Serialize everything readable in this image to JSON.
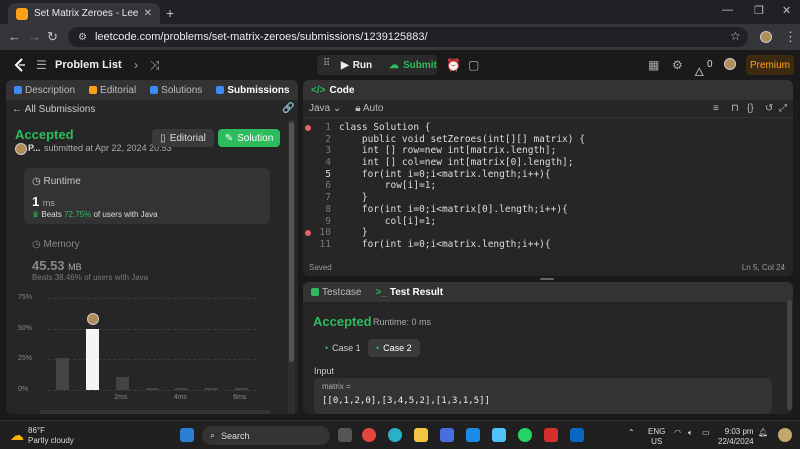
{
  "browser": {
    "tab_title": "Set Matrix Zeroes - LeetCode",
    "url": "leetcode.com/problems/set-matrix-zeroes/submissions/1239125883/"
  },
  "topbar": {
    "problem_list": "Problem List",
    "run": "Run",
    "submit": "Submit",
    "streak_count": "0",
    "premium": "Premium"
  },
  "left": {
    "tabs": [
      "Description",
      "Editorial",
      "Solutions",
      "Submissions"
    ],
    "back": "All Submissions",
    "status": "Accepted",
    "author": "P...",
    "submitted": "submitted at Apr 22, 2024 20:53",
    "editorial_btn": "Editorial",
    "solution_btn": "Solution",
    "runtime": {
      "label": "Runtime",
      "value": "1",
      "unit": "ms",
      "beats_prefix": "Beats",
      "beats_pct": "72.75%",
      "beats_suffix": "of users with Java"
    },
    "memory": {
      "label": "Memory",
      "value": "45.53",
      "unit": "MB",
      "beats_prefix": "Beats",
      "beats_pct": "38.46%",
      "beats_suffix": "of users with Java"
    }
  },
  "chart_data": {
    "type": "bar",
    "yticks": [
      "75%",
      "50%",
      "25%",
      "0%"
    ],
    "ylim": [
      0,
      75
    ],
    "xticks": [
      "2ms",
      "4ms",
      "6ms"
    ],
    "values": [
      26,
      50,
      11,
      1,
      1,
      1,
      1
    ],
    "highlight_index": 1
  },
  "code": {
    "title": "Code",
    "language": "Java",
    "format": "Auto",
    "saved": "Saved",
    "cursor": "Ln 5, Col 24",
    "lines": [
      "class Solution {",
      "    public void setZeroes(int[][] matrix) {",
      "    int [] row=new int[matrix.length];",
      "    int [] col=new int[matrix[0].length];",
      "    for(int i=0;i<matrix.length;i++){",
      "        row[i]=1;",
      "    }",
      "    for(int i=0;i<matrix[0].length;i++){",
      "        col[i]=1;",
      "    }",
      "    for(int i=0;i<matrix.length;i++){"
    ]
  },
  "test": {
    "tabs": [
      "Testcase",
      "Test Result"
    ],
    "status": "Accepted",
    "runtime": "Runtime: 0 ms",
    "cases": [
      "Case 1",
      "Case 2"
    ],
    "input_label": "Input",
    "var_name": "matrix =",
    "var_value": "[[0,1,2,0],[3,4,5,2],[1,3,1,5]]"
  },
  "taskbar": {
    "temp": "86°F",
    "weather": "Partly cloudy",
    "search": "Search",
    "lang1": "ENG",
    "lang2": "US",
    "time": "9:03 pm",
    "date": "22/4/2024"
  }
}
